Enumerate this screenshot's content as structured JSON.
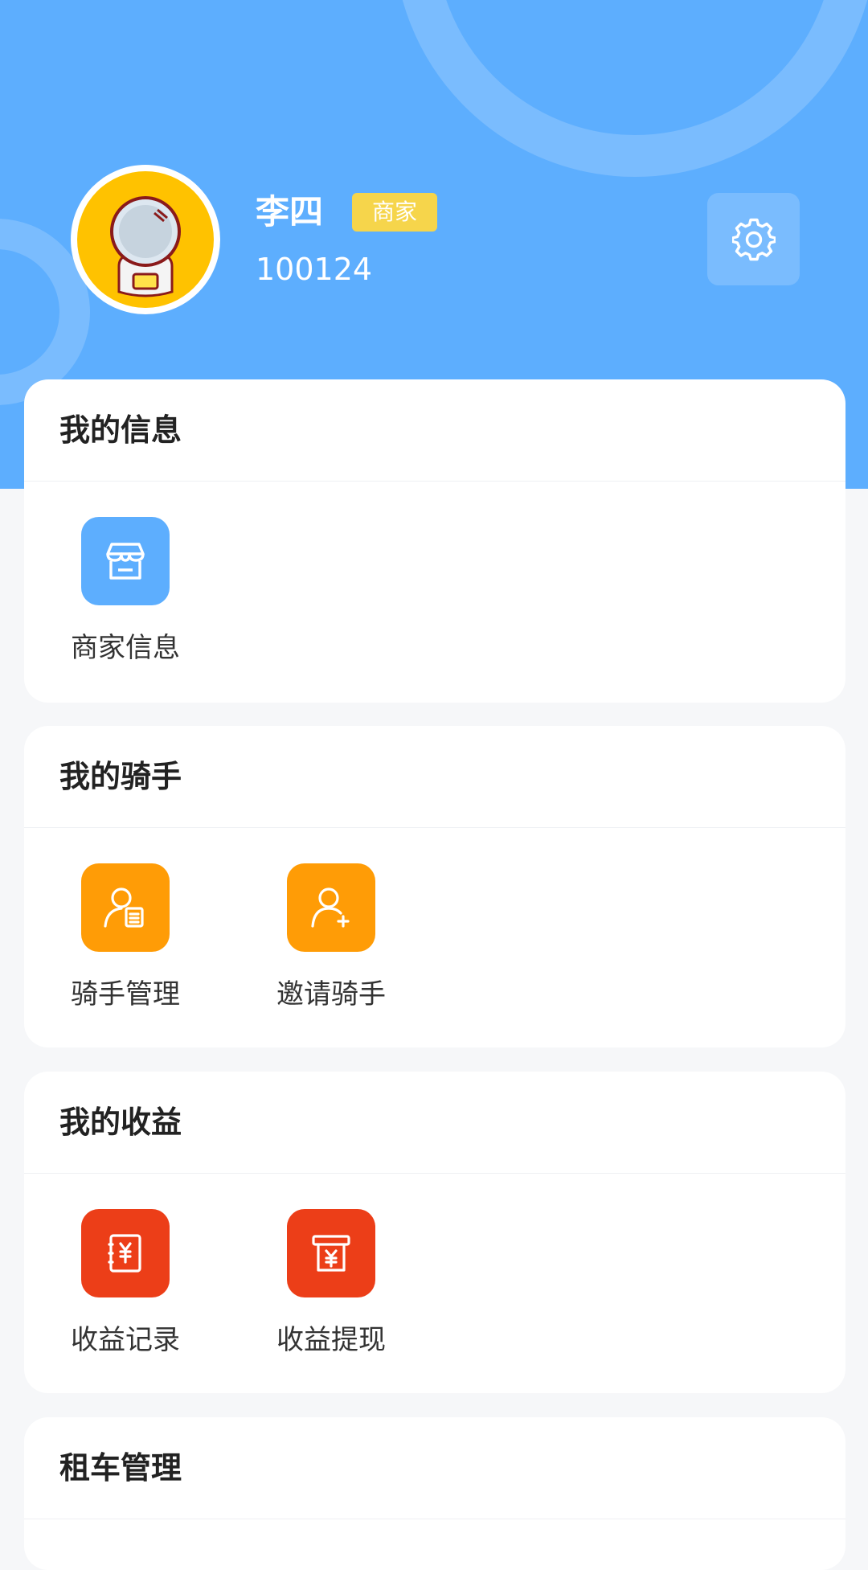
{
  "profile": {
    "name": "李四",
    "role_badge": "商家",
    "user_id": "100124"
  },
  "sections": {
    "info": {
      "title": "我的信息",
      "items": [
        {
          "label": "商家信息",
          "icon": "store-icon"
        }
      ]
    },
    "riders": {
      "title": "我的骑手",
      "items": [
        {
          "label": "骑手管理",
          "icon": "rider-management-icon"
        },
        {
          "label": "邀请骑手",
          "icon": "invite-rider-icon"
        }
      ]
    },
    "earnings": {
      "title": "我的收益",
      "items": [
        {
          "label": "收益记录",
          "icon": "earnings-record-icon"
        },
        {
          "label": "收益提现",
          "icon": "earnings-withdraw-icon"
        }
      ]
    },
    "rental": {
      "title": "租车管理"
    }
  },
  "colors": {
    "header_bg": "#5daefe",
    "badge": "#f6d54b",
    "blue_icon": "#5daefe",
    "orange_icon": "#ff9c06",
    "red_icon": "#ec3e18"
  }
}
